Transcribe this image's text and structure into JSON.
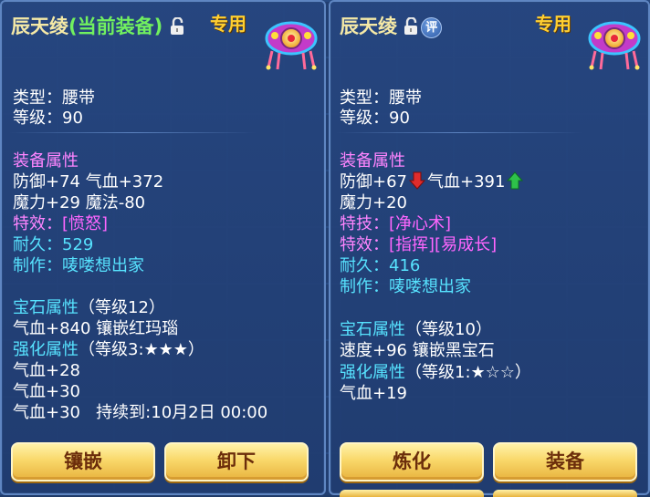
{
  "colors": {
    "title": "#f5e9a6",
    "current_equipped": "#71f05f",
    "exclusive": "#ffcf31",
    "section_header": "#ff85ff",
    "accent_cyan": "#57e3ff",
    "magenta": "#ff66ff",
    "button_text": "#6b2d0b",
    "down_arrow": "#e02c2c",
    "up_arrow": "#2ec24a"
  },
  "left": {
    "title_name": "辰天绫",
    "title_current": "(当前装备)",
    "lock_icon": "unlock-icon",
    "exclusive": "专用",
    "item_icon": "belt-ornament-icon",
    "type_line": "类型：腰带",
    "level_line": "等级：90",
    "equip_attr_header": "装备属性",
    "attr_line1": "防御+74 气血+372",
    "attr_line2": "魔力+29 魔法-80",
    "effect_label": "特效：",
    "effect_value": "[愤怒]",
    "durability_label": "耐久：",
    "durability_value": "529",
    "maker_label": "制作：",
    "maker_value": "唛喽想出家",
    "gem_header": "宝石属性",
    "gem_level": "（等级12）",
    "gem_line": "气血+840 镶嵌红玛瑙",
    "enhance_header": "强化属性",
    "enhance_level": "（等级3:★★★）",
    "enhance_line1": "气血+28",
    "enhance_line2": "气血+30",
    "enhance_line3": "气血+30",
    "enhance_duration": "持续到:10月2日 00:00",
    "btn_inlay": "镶嵌",
    "btn_unequip": "卸下"
  },
  "right": {
    "title_name": "辰天绫",
    "lock_icon": "unlock-icon",
    "eval_icon_text": "评",
    "exclusive": "专用",
    "item_icon": "belt-ornament-icon",
    "type_line": "类型：腰带",
    "level_line": "等级：90",
    "equip_attr_header": "装备属性",
    "defense": "防御+67",
    "hp": "气血+391",
    "attr_line2": "魔力+20",
    "skill_label": "特技：",
    "skill_value": "[净心术]",
    "effect_label": "特效：",
    "effect_value": "[指挥][易成长]",
    "durability_label": "耐久：",
    "durability_value": "416",
    "maker_label": "制作：",
    "maker_value": "唛喽想出家",
    "gem_header": "宝石属性",
    "gem_level": "（等级10）",
    "gem_line": "速度+96 镶嵌黑宝石",
    "enhance_header": "强化属性",
    "enhance_level": "（等级1:★☆☆）",
    "enhance_line1": "气血+19",
    "btn_refine": "炼化",
    "btn_equip": "装备"
  }
}
